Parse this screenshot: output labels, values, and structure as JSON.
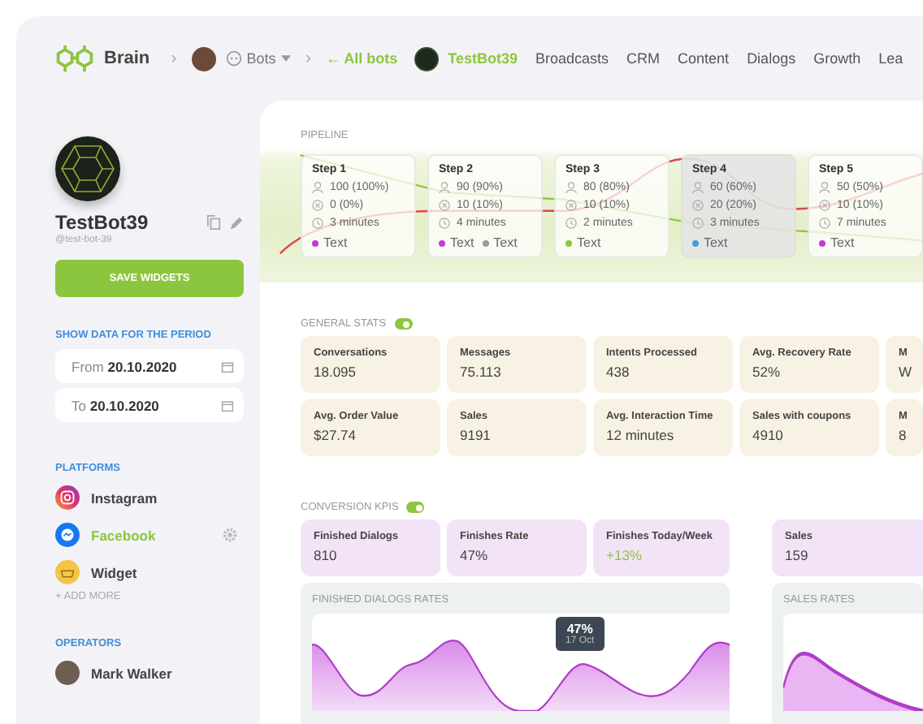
{
  "nav": {
    "brand": "Brain",
    "separator": "›",
    "bots_label": "Bots",
    "back_link": "← All bots",
    "items": [
      {
        "label": "TestBot39",
        "selected": true,
        "kind": "bot"
      },
      {
        "label": "Broadcasts",
        "selected": false,
        "kind": "link"
      },
      {
        "label": "CRM",
        "selected": false,
        "kind": "link"
      },
      {
        "label": "Content",
        "selected": false,
        "kind": "link"
      },
      {
        "label": "Dialogs",
        "selected": false,
        "kind": "link"
      },
      {
        "label": "Growth",
        "selected": false,
        "kind": "link"
      },
      {
        "label": "Lea",
        "selected": false,
        "kind": "link"
      }
    ]
  },
  "sidebar": {
    "bot_name": "TestBot39",
    "bot_handle": "@test-bot-39",
    "save_button": "SAVE WIDGETS",
    "period": {
      "title": "SHOW DATA FOR THE PERIOD",
      "fields": [
        {
          "label": "From",
          "value": "20.10.2020"
        },
        {
          "label": "To",
          "value": "20.10.2020"
        }
      ]
    },
    "platforms": {
      "title": "PLATFORMS",
      "items": [
        {
          "name": "Instagram",
          "kind": "instagram",
          "selected": false
        },
        {
          "name": "Facebook",
          "kind": "facebook",
          "selected": true
        },
        {
          "name": "Widget",
          "kind": "widget",
          "selected": false
        }
      ],
      "add_more": "+ ADD MORE"
    },
    "operators": {
      "title": "OPERATORS",
      "items": [
        {
          "name": "Mark Walker"
        }
      ]
    }
  },
  "pipeline": {
    "title": "PIPELINE",
    "steps": [
      {
        "title": "Step 1",
        "users": "100 (100%)",
        "dropped": "0 (0%)",
        "time": "3 minutes",
        "selected": false,
        "tags": [
          {
            "label": "Text",
            "color": "#c23ad6"
          }
        ]
      },
      {
        "title": "Step 2",
        "users": "90 (90%)",
        "dropped": "10 (10%)",
        "time": "4 minutes",
        "selected": false,
        "tags": [
          {
            "label": "Text",
            "color": "#c23ad6"
          },
          {
            "label": "Text",
            "color": "#9a9a9a"
          }
        ]
      },
      {
        "title": "Step 3",
        "users": "80 (80%)",
        "dropped": "10 (10%)",
        "time": "2 minutes",
        "selected": false,
        "tags": [
          {
            "label": "Text",
            "color": "#8cc63f"
          }
        ]
      },
      {
        "title": "Step 4",
        "users": "60 (60%)",
        "dropped": "20 (20%)",
        "time": "3 minutes",
        "selected": true,
        "tags": [
          {
            "label": "Text",
            "color": "#3f9de0"
          }
        ]
      },
      {
        "title": "Step 5",
        "users": "50 (50%)",
        "dropped": "10 (10%)",
        "time": "7 minutes",
        "selected": false,
        "tags": [
          {
            "label": "Text",
            "color": "#c23ad6"
          }
        ]
      }
    ]
  },
  "general_stats": {
    "title": "GENERAL STATS",
    "on": true,
    "rows": [
      [
        {
          "label": "Conversations",
          "value": "18.095"
        },
        {
          "label": "Messages",
          "value": "75.113"
        },
        {
          "label": "Intents Processed",
          "value": "438"
        },
        {
          "label": "Avg. Recovery Rate",
          "value": "52%"
        },
        {
          "label": "M",
          "value": "W"
        }
      ],
      [
        {
          "label": "Avg. Order Value",
          "value": "$27.74"
        },
        {
          "label": "Sales",
          "value": "9191"
        },
        {
          "label": "Avg. Interaction Time",
          "value": "12 minutes"
        },
        {
          "label": "Sales with coupons",
          "value": "4910"
        },
        {
          "label": "M",
          "value": "8"
        }
      ]
    ]
  },
  "conversion_kpis": {
    "title": "CONVERSION KPIS",
    "on": true,
    "cards": [
      {
        "label": "Finished Dialogs",
        "value": "810",
        "positive": false
      },
      {
        "label": "Finishes Rate",
        "value": "47%",
        "positive": false
      },
      {
        "label": "Finishes Today/Week",
        "value": "+13%",
        "positive": true
      }
    ],
    "side_cards": [
      {
        "label": "Sales",
        "value": "159",
        "positive": false
      }
    ]
  },
  "charts": [
    {
      "title": "FINISHED DIALOGS RATES",
      "tooltip": {
        "value": "47%",
        "date": "17 Oct"
      }
    },
    {
      "title": "SALES RATES"
    }
  ]
}
